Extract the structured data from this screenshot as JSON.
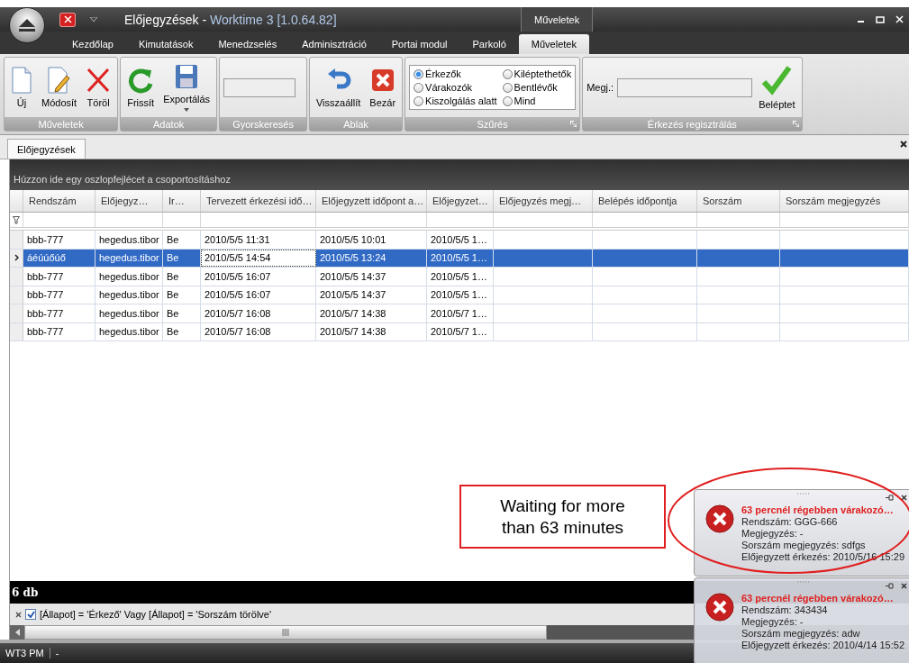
{
  "window": {
    "title": "Előjegyzések",
    "separator": "-",
    "app": "Worktime 3 [1.0.64.82]",
    "context_tab": "Műveletek"
  },
  "menu_tabs": [
    {
      "label": "Kezdőlap",
      "selected": false
    },
    {
      "label": "Kimutatások",
      "selected": false
    },
    {
      "label": "Menedzselés",
      "selected": false
    },
    {
      "label": "Adminisztráció",
      "selected": false
    },
    {
      "label": "Portai modul",
      "selected": false
    },
    {
      "label": "Parkoló",
      "selected": false
    },
    {
      "label": "Műveletek",
      "selected": true
    }
  ],
  "ribbon_groups": [
    {
      "title": "Műveletek",
      "launcher": false,
      "items": [
        {
          "kind": "button",
          "label": "Új"
        },
        {
          "kind": "button",
          "label": "Módosít"
        },
        {
          "kind": "button",
          "label": "Töröl"
        }
      ]
    },
    {
      "title": "Adatok",
      "launcher": false,
      "items": [
        {
          "kind": "button",
          "label": "Frissít"
        },
        {
          "kind": "button",
          "label": "Exportálás",
          "dropdown": true
        }
      ]
    },
    {
      "title": "Gyorskeresés",
      "launcher": false,
      "items": [
        {
          "kind": "search"
        }
      ]
    },
    {
      "title": "Ablak",
      "launcher": false,
      "items": [
        {
          "kind": "button",
          "label": "Visszaállít"
        },
        {
          "kind": "button",
          "label": "Bezár"
        }
      ]
    },
    {
      "title": "Szűrés",
      "launcher": true,
      "items": [
        {
          "kind": "radios",
          "options": [
            {
              "label": "Érkezők",
              "selected": true
            },
            {
              "label": "Kiléptethetők",
              "selected": false
            },
            {
              "label": "Várakozók",
              "selected": false
            },
            {
              "label": "Bentlévők",
              "selected": false
            },
            {
              "label": "Kiszolgálás alatt",
              "selected": false
            },
            {
              "label": "Mind",
              "selected": false
            }
          ]
        }
      ]
    },
    {
      "title": "Érkezés regisztrálás",
      "launcher": true,
      "items": [
        {
          "kind": "field",
          "label": "Megj.:"
        },
        {
          "kind": "button",
          "label": "Beléptet"
        }
      ]
    }
  ],
  "document_tab": {
    "label": "Előjegyzések",
    "selected": true
  },
  "grid": {
    "group_hint": "Húzzon ide egy oszlopfejlécet a csoportosításhoz",
    "columns": [
      {
        "label": "Rendszám",
        "focused": false
      },
      {
        "label": "Előjegyz…",
        "focused": false
      },
      {
        "label": "Ir…",
        "focused": false
      },
      {
        "label": "Tervezett érkezési idő…",
        "focused": true
      },
      {
        "label": "Előjegyzett időpont a…",
        "focused": false
      },
      {
        "label": "Előjegyzet…",
        "focused": false
      },
      {
        "label": "Előjegyzés megj…",
        "focused": false
      },
      {
        "label": "Belépés időpontja",
        "focused": false
      },
      {
        "label": "Sorszám",
        "focused": false
      },
      {
        "label": "Sorszám megjegyzés",
        "focused": false
      }
    ],
    "rows": [
      {
        "selected": false,
        "cells": [
          "bbb-777",
          "hegedus.tibor",
          "Be",
          "2010/5/5 11:31",
          "2010/5/5 10:01",
          "2010/5/5 1…"
        ]
      },
      {
        "selected": true,
        "cells": [
          "áéúúőúő",
          "hegedus.tibor",
          "Be",
          "2010/5/5 14:54",
          "2010/5/5 13:24",
          "2010/5/5 1…"
        ]
      },
      {
        "selected": false,
        "cells": [
          "bbb-777",
          "hegedus.tibor",
          "Be",
          "2010/5/5 16:07",
          "2010/5/5 14:37",
          "2010/5/5 1…"
        ]
      },
      {
        "selected": false,
        "cells": [
          "bbb-777",
          "hegedus.tibor",
          "Be",
          "2010/5/5 16:07",
          "2010/5/5 14:37",
          "2010/5/5 1…"
        ]
      },
      {
        "selected": false,
        "cells": [
          "bbb-777",
          "hegedus.tibor",
          "Be",
          "2010/5/7 16:08",
          "2010/5/7 14:38",
          "2010/5/7 1…"
        ]
      },
      {
        "selected": false,
        "cells": [
          "bbb-777",
          "hegedus.tibor",
          "Be",
          "2010/5/7 16:08",
          "2010/5/7 14:38",
          "2010/5/7 1…"
        ]
      }
    ],
    "footer": "6 db",
    "filter": {
      "checked": true,
      "text": "[Állapot] = 'Érkező' Vagy [Állapot] = 'Sorszám törölve'"
    }
  },
  "status_bar": [
    "WT3 PM",
    "-"
  ],
  "callout": "Waiting for more than 63 minutes",
  "notifications": [
    {
      "title": "63 percnél régebben várakozó…",
      "lines": [
        "Rendszám: GGG-666",
        "Megjegyzés: -",
        "Sorszám megjegyzés: sdfgs",
        "Előjegyzett érkezés: 2010/5/16 15:29"
      ]
    },
    {
      "title": "63 percnél régebben várakozó…",
      "lines": [
        "Rendszám: 343434",
        "Megjegyzés: -",
        "Sorszám megjegyzés: adw",
        "Előjegyzett érkezés: 2010/4/14 15:52"
      ]
    }
  ]
}
